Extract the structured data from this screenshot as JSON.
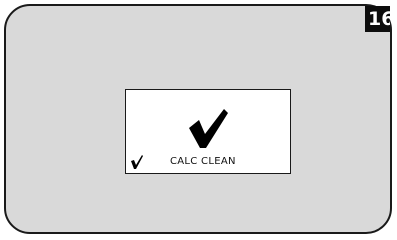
{
  "page_number": "16",
  "display": {
    "status_text": "CALC CLEAN",
    "icons": {
      "main": "checkmark-icon",
      "indicator": "checkmark-icon"
    }
  }
}
